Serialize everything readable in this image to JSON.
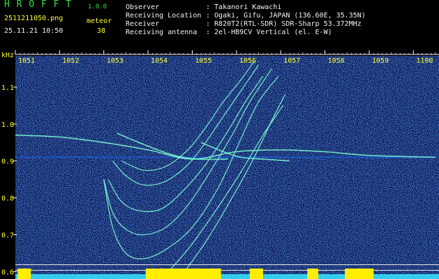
{
  "header": {
    "app_title": "H R O F F T",
    "app_version": "1.0.0",
    "filename": "2511211050.png",
    "datetime": "25.11.21 10:50",
    "meteor_label": "meteor",
    "meteor_count": "38",
    "info": [
      {
        "label": "Observer",
        "value": ": Takanori Kawachi"
      },
      {
        "label": "Receiving Location",
        "value": ": Ogaki, Gifu, JAPAN (136.60E, 35.35N)"
      },
      {
        "label": "Receiver",
        "value": ": R820T2(RTL-SDR) SDR-Sharp 53.372MHz"
      },
      {
        "label": "Receiving antenna",
        "value": ": 2el-HB9CV Vertical (el. E-W)"
      }
    ]
  },
  "colors": {
    "background": "#000000",
    "spectrogram_bg": "#08104a",
    "noise": "#1f5fe0",
    "trace": "#7fffd4",
    "header_text": "#ffff33",
    "title_green": "#36e03a",
    "signal_bar": "#ffee00",
    "base_bar": "#33ccee"
  },
  "chart_data": {
    "type": "heatmap",
    "y_unit_label": "kHz",
    "time_ticks": [
      "1051",
      "1052",
      "1053",
      "1054",
      "1055",
      "1056",
      "1057",
      "1058",
      "1059",
      "1100"
    ],
    "freq_ticks": [
      "1.1",
      "1.0",
      "0.9",
      "0.8",
      "0.7",
      "0.6"
    ],
    "freq_tick_values": [
      1.1,
      1.0,
      0.9,
      0.8,
      0.7,
      0.6
    ],
    "x_range_minutes": [
      0,
      9.5
    ],
    "y_range_khz": [
      0.58,
      1.185
    ],
    "carrier_khz": 0.91,
    "horizontal_lines_khz": [
      0.62,
      0.605,
      0.59
    ],
    "traces": [
      {
        "kind": "plane_echo_lower",
        "points": [
          [
            2.0,
            0.85
          ],
          [
            2.2,
            0.72
          ],
          [
            2.5,
            0.65
          ],
          [
            2.9,
            0.635
          ],
          [
            3.4,
            0.66
          ],
          [
            4.0,
            0.72
          ],
          [
            4.6,
            0.83
          ],
          [
            5.1,
            0.96
          ],
          [
            5.5,
            1.06
          ],
          [
            5.95,
            1.13
          ]
        ]
      },
      {
        "kind": "plane_echo_lower",
        "points": [
          [
            2.0,
            0.85
          ],
          [
            2.2,
            0.76
          ],
          [
            2.5,
            0.715
          ],
          [
            2.9,
            0.7
          ],
          [
            3.4,
            0.72
          ],
          [
            3.9,
            0.78
          ],
          [
            4.4,
            0.87
          ],
          [
            4.9,
            0.97
          ],
          [
            5.3,
            1.06
          ],
          [
            5.8,
            1.15
          ]
        ]
      },
      {
        "kind": "plane_echo_lower",
        "points": [
          [
            2.1,
            0.85
          ],
          [
            2.4,
            0.79
          ],
          [
            2.8,
            0.765
          ],
          [
            3.3,
            0.77
          ],
          [
            3.8,
            0.82
          ],
          [
            4.3,
            0.89
          ],
          [
            4.8,
            0.98
          ],
          [
            5.2,
            1.06
          ],
          [
            5.6,
            1.13
          ]
        ]
      },
      {
        "kind": "plane_echo_upper",
        "points": [
          [
            2.2,
            0.9
          ],
          [
            2.5,
            0.86
          ],
          [
            2.9,
            0.835
          ],
          [
            3.4,
            0.845
          ],
          [
            3.9,
            0.89
          ],
          [
            4.3,
            0.95
          ],
          [
            4.7,
            1.02
          ],
          [
            5.1,
            1.09
          ],
          [
            5.5,
            1.16
          ]
        ]
      },
      {
        "kind": "plane_echo_upper",
        "points": [
          [
            2.4,
            0.9
          ],
          [
            2.9,
            0.875
          ],
          [
            3.4,
            0.885
          ],
          [
            3.9,
            0.93
          ],
          [
            4.3,
            0.99
          ],
          [
            4.7,
            1.06
          ],
          [
            5.1,
            1.12
          ],
          [
            5.4,
            1.17
          ]
        ]
      },
      {
        "kind": "descending_diagonal",
        "points": [
          [
            3.7,
            0.58
          ],
          [
            4.3,
            0.68
          ],
          [
            4.9,
            0.8
          ],
          [
            5.4,
            0.91
          ],
          [
            5.8,
            1.01
          ],
          [
            6.1,
            1.08
          ]
        ]
      },
      {
        "kind": "descending_diagonal",
        "points": [
          [
            3.3,
            0.58
          ],
          [
            3.9,
            0.66
          ],
          [
            4.5,
            0.76
          ],
          [
            5.1,
            0.87
          ],
          [
            5.6,
            0.97
          ],
          [
            6.05,
            1.05
          ]
        ]
      },
      {
        "kind": "band_cross",
        "points": [
          [
            0.0,
            0.97
          ],
          [
            1.0,
            0.965
          ],
          [
            2.0,
            0.95
          ],
          [
            3.0,
            0.93
          ],
          [
            4.0,
            0.905
          ],
          [
            5.0,
            0.925
          ],
          [
            6.0,
            0.93
          ],
          [
            7.0,
            0.925
          ],
          [
            8.0,
            0.915
          ],
          [
            9.5,
            0.91
          ]
        ]
      },
      {
        "kind": "band_cross",
        "points": [
          [
            2.3,
            0.975
          ],
          [
            3.0,
            0.94
          ],
          [
            3.6,
            0.915
          ],
          [
            4.1,
            0.905
          ],
          [
            4.8,
            0.905
          ]
        ]
      },
      {
        "kind": "band_cross",
        "points": [
          [
            4.2,
            0.95
          ],
          [
            4.6,
            0.93
          ],
          [
            5.1,
            0.91
          ],
          [
            5.6,
            0.905
          ],
          [
            6.2,
            0.9
          ]
        ]
      }
    ],
    "signal_bursts_minutes": [
      [
        2.95,
        4.65
      ],
      [
        7.45,
        8.1
      ],
      [
        0.05,
        0.35
      ],
      [
        5.3,
        5.6
      ],
      [
        6.6,
        6.85
      ]
    ]
  }
}
